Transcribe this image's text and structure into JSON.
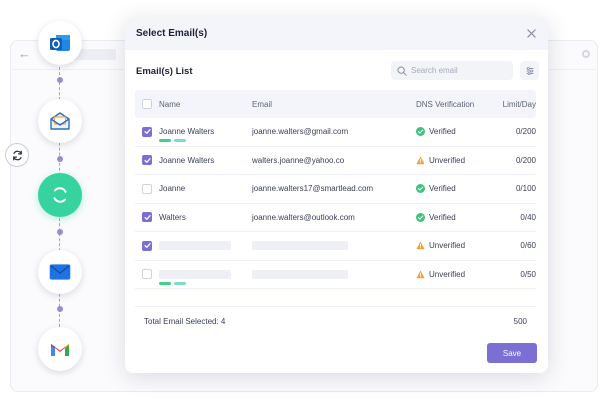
{
  "modal": {
    "title": "Select Email(s)",
    "list_title": "Email(s) List",
    "search_placeholder": "Search email",
    "save_label": "Save",
    "total_label": "Total Email Selected: 4",
    "total_limit": "500"
  },
  "table": {
    "headers": {
      "name": "Name",
      "email": "Email",
      "dns": "DNS Verification",
      "limit": "Limit/Day"
    },
    "rows": [
      {
        "checked": true,
        "name": "Joanne Walters",
        "email": "joanne.walters@gmail.com",
        "dns": "Verified",
        "dns_status": "verified",
        "limit": "0/200",
        "tags": true
      },
      {
        "checked": true,
        "name": "Joanne Walters",
        "email": "walters.joanne@yahoo.co",
        "dns": "Unverified",
        "dns_status": "unverified",
        "limit": "0/200",
        "tags": false
      },
      {
        "checked": false,
        "name": "Joanne",
        "email": "joanne.walters17@smartlead.com",
        "dns": "Verified",
        "dns_status": "verified",
        "limit": "0/100",
        "tags": false
      },
      {
        "checked": true,
        "name": "Walters",
        "email": "joanne.walters@outlook.com",
        "dns": "Verified",
        "dns_status": "verified",
        "limit": "0/40",
        "tags": false
      },
      {
        "checked": true,
        "name": "",
        "email": "",
        "dns": "Unverified",
        "dns_status": "unverified",
        "limit": "0/60",
        "tags": false,
        "placeholder": true
      },
      {
        "checked": false,
        "name": "",
        "email": "",
        "dns": "Unverified",
        "dns_status": "unverified",
        "limit": "0/50",
        "tags": true,
        "placeholder": true
      }
    ]
  },
  "flow": {
    "nodes": [
      "outlook-logo",
      "open-mail-icon",
      "sync-icon",
      "mail-icon",
      "gmail-logo"
    ]
  },
  "colors": {
    "accent": "#7b6fd4",
    "verified": "#3cc47c",
    "unverified": "#f0a13a",
    "sync_node": "#36d39e",
    "tag_green": "#3fd08f",
    "tag_teal": "#7fd9d3"
  }
}
